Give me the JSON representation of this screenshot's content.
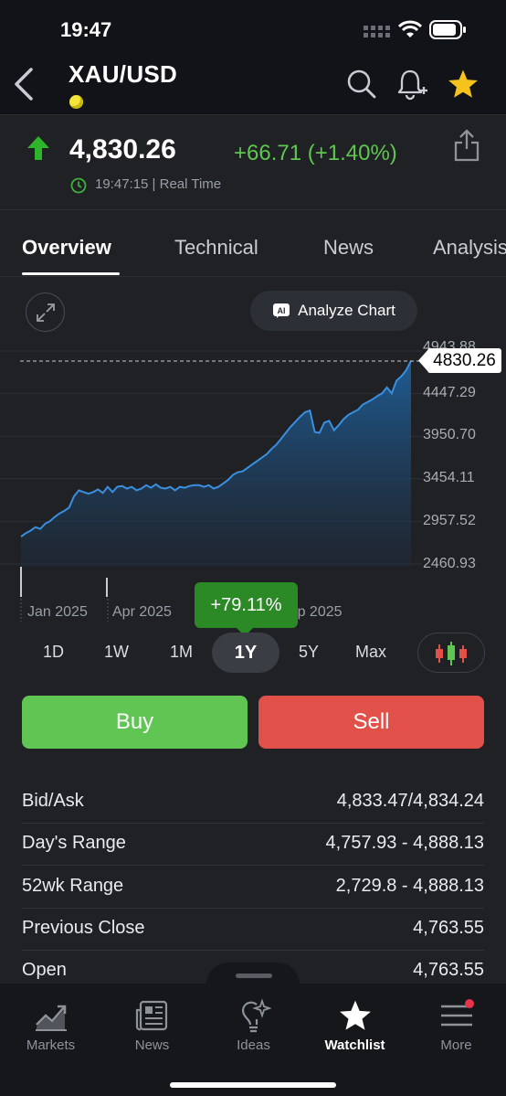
{
  "status": {
    "time": "19:47"
  },
  "header": {
    "symbol": "XAU/USD"
  },
  "quote": {
    "price": "4,830.26",
    "change": "+66.71 (+1.40%)",
    "realtime": "19:47:15 | Real Time"
  },
  "tabs": [
    {
      "label": "Overview"
    },
    {
      "label": "Technical"
    },
    {
      "label": "News"
    },
    {
      "label": "Analysis"
    }
  ],
  "chart": {
    "analyze_label": "Analyze Chart",
    "price_tag": "4830.26",
    "y_labels": [
      "4943.88",
      "4447.29",
      "3950.70",
      "3454.11",
      "2957.52",
      "2460.93"
    ],
    "x_labels": [
      "Jan 2025",
      "Apr 2025",
      "Sep 2025"
    ],
    "tooltip": "+79.11%"
  },
  "chart_data": {
    "type": "area",
    "y_ticks": [
      4943.88,
      4447.29,
      3950.7,
      3454.11,
      2957.52,
      2460.93
    ],
    "ylim": [
      2460.93,
      4943.88
    ],
    "x_labels": [
      "Jan 2025",
      "Apr 2025",
      "Sep 2025"
    ],
    "current": 4830.26,
    "change_pct": "+79.11%",
    "values": [
      2780,
      2820,
      2850,
      2890,
      2870,
      2930,
      2960,
      3010,
      3050,
      3080,
      3120,
      3250,
      3320,
      3300,
      3280,
      3300,
      3330,
      3290,
      3360,
      3300,
      3360,
      3370,
      3340,
      3360,
      3320,
      3340,
      3380,
      3350,
      3390,
      3350,
      3340,
      3360,
      3320,
      3360,
      3350,
      3370,
      3380,
      3380,
      3360,
      3380,
      3340,
      3360,
      3400,
      3440,
      3500,
      3530,
      3540,
      3580,
      3620,
      3660,
      3700,
      3740,
      3800,
      3850,
      3920,
      3990,
      4060,
      4120,
      4180,
      4230,
      4250,
      4000,
      3990,
      4110,
      4130,
      4020,
      4080,
      4150,
      4200,
      4230,
      4260,
      4320,
      4350,
      4380,
      4420,
      4450,
      4520,
      4450,
      4600,
      4650,
      4720,
      4830
    ]
  },
  "ranges": [
    {
      "label": "1D"
    },
    {
      "label": "1W"
    },
    {
      "label": "1M"
    },
    {
      "label": "1Y"
    },
    {
      "label": "5Y"
    },
    {
      "label": "Max"
    }
  ],
  "actions": {
    "buy": "Buy",
    "sell": "Sell"
  },
  "stats": [
    {
      "k": "Bid/Ask",
      "v": "4,833.47/4,834.24"
    },
    {
      "k": "Day's Range",
      "v": "4,757.93 - 4,888.13"
    },
    {
      "k": "52wk Range",
      "v": "2,729.8 - 4,888.13"
    },
    {
      "k": "Previous Close",
      "v": "4,763.55"
    },
    {
      "k": "Open",
      "v": "4,763.55"
    }
  ],
  "nav": [
    {
      "label": "Markets"
    },
    {
      "label": "News"
    },
    {
      "label": "Ideas"
    },
    {
      "label": "Watchlist"
    },
    {
      "label": "More"
    }
  ],
  "colors": {
    "up": "#5fc650",
    "buy": "#61c553",
    "sell": "#e2504a",
    "line": "#3a8fe0",
    "star": "#f6c21c"
  }
}
